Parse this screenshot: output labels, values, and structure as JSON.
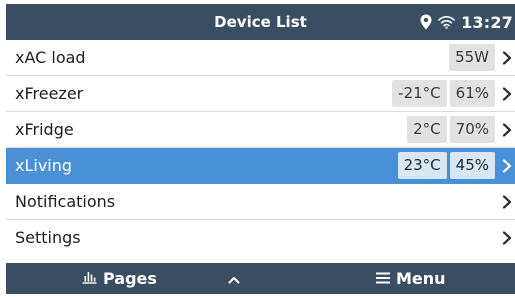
{
  "header": {
    "title": "Device List",
    "time": "13:27",
    "icons": [
      "location-pin-icon",
      "wifi-icon"
    ]
  },
  "rows": [
    {
      "label": "xAC load",
      "values": [
        "55W"
      ],
      "selected": false
    },
    {
      "label": "xFreezer",
      "values": [
        "-21°C",
        "61%"
      ],
      "selected": false
    },
    {
      "label": "xFridge",
      "values": [
        "2°C",
        "70%"
      ],
      "selected": false
    },
    {
      "label": "xLiving",
      "values": [
        "23°C",
        "45%"
      ],
      "selected": true
    },
    {
      "label": "Notifications",
      "values": [],
      "selected": false
    },
    {
      "label": "Settings",
      "values": [],
      "selected": false
    }
  ],
  "footer": {
    "pages_label": "Pages",
    "menu_label": "Menu",
    "icons": [
      "bar-chart-icon",
      "chevron-up-icon",
      "hamburger-menu-icon"
    ]
  },
  "colors": {
    "bar_background": "#394d63",
    "selected_row": "#4a90d6",
    "value_pill": "#e2e2e2"
  }
}
